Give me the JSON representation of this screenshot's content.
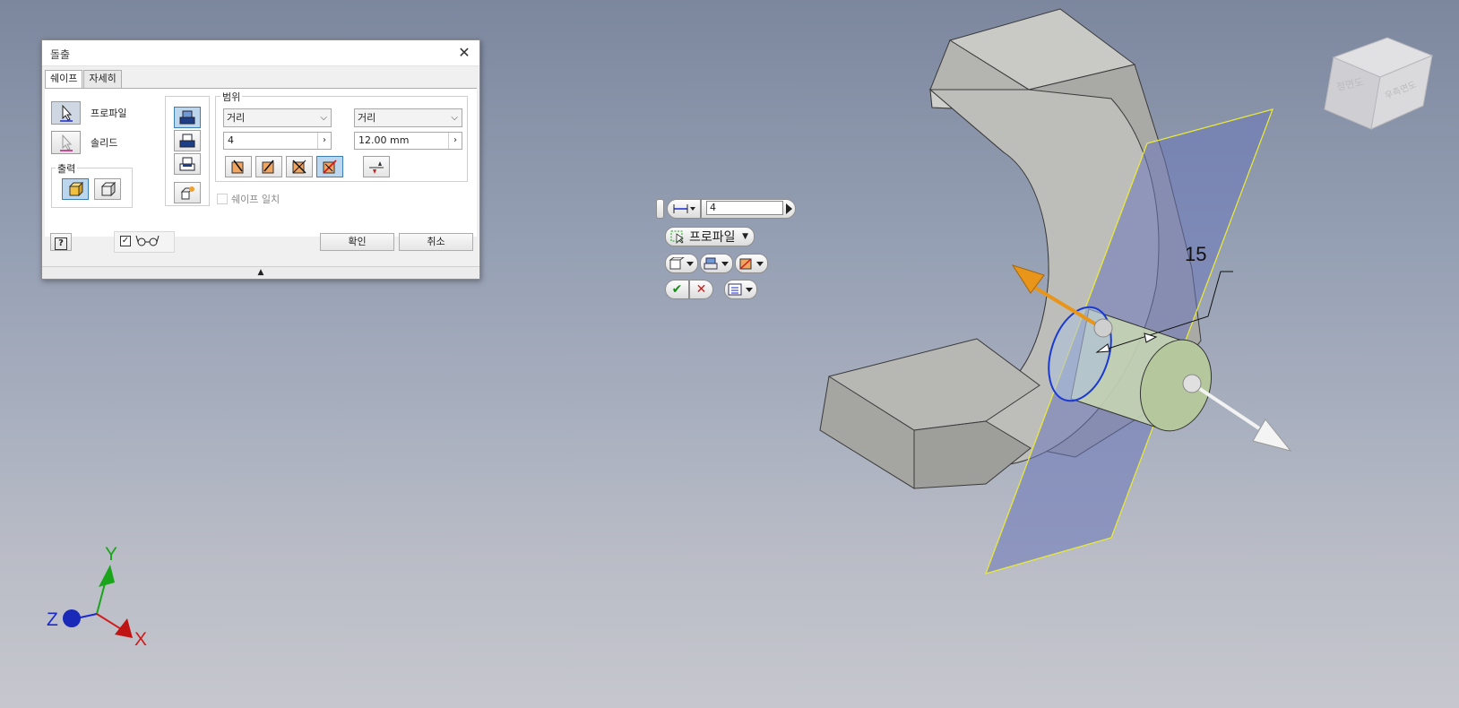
{
  "dialog": {
    "title": "돌출",
    "tabs": [
      "쉐이프",
      "자세히"
    ],
    "profile_label": "프로파일",
    "solid_label": "솔리드",
    "output_group": "출력",
    "extent_group": "범위",
    "extent1_type": "거리",
    "extent2_type": "거리",
    "distance1": "4",
    "distance2": "12.00 mm",
    "match_shape": "쉐이프 일치",
    "ok": "확인",
    "cancel": "취소"
  },
  "mini_toolbar": {
    "distance_value": "4",
    "profile_label": "프로파일"
  },
  "viewport": {
    "dimension_label": "15",
    "view_cube_front": "정면도",
    "view_cube_right": "우측면도",
    "axis_x": "X",
    "axis_y": "Y",
    "axis_z": "Z"
  },
  "colors": {
    "accent": "#3c7fb1",
    "plane": "#6a76b8",
    "arrow_orange": "#e8951a",
    "axis_x": "#d11a1a",
    "axis_y": "#1aa51a",
    "axis_z": "#1a2ad1"
  }
}
